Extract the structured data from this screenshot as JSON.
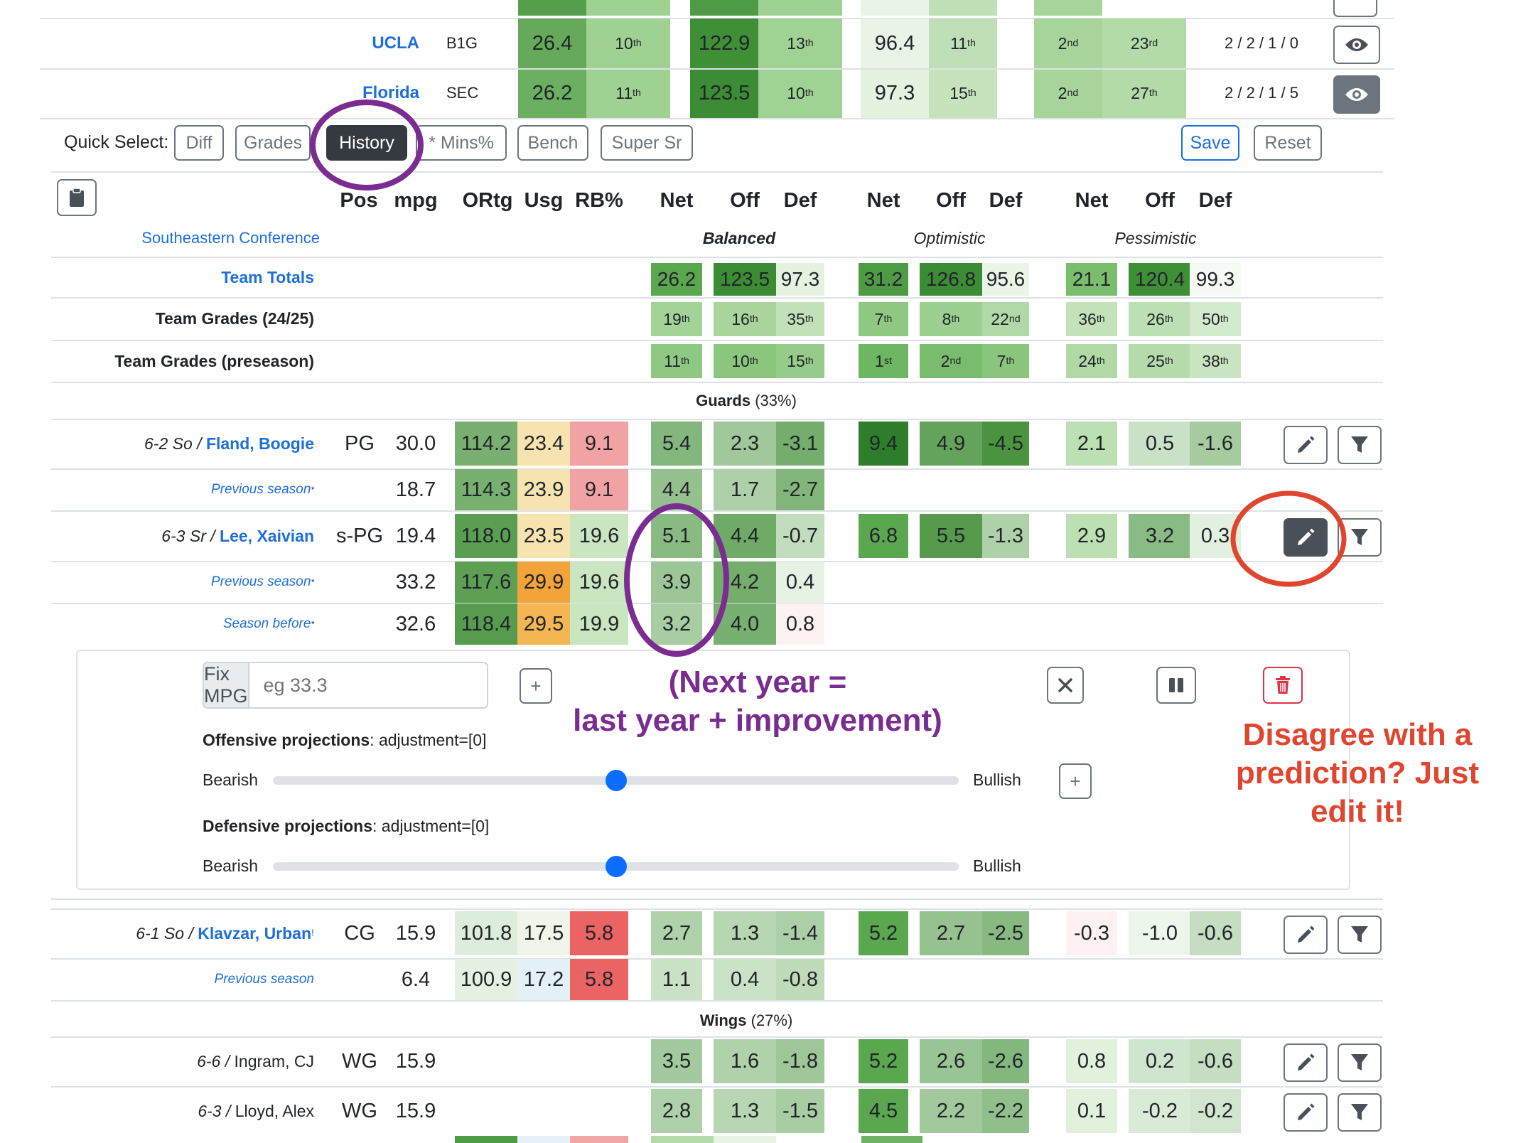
{
  "top_rows": [
    {
      "team": "UCLA",
      "conf": "B1G",
      "adj_margin": "26.4",
      "adj_margin_rank": "10",
      "adj_off": "122.9",
      "adj_off_rank": "13",
      "adj_def": "96.4",
      "adj_def_rank": "11",
      "rank_a": "2",
      "rank_b": "23",
      "record": "2 / 2 / 1 / 0"
    },
    {
      "team": "Florida",
      "conf": "SEC",
      "adj_margin": "26.2",
      "adj_margin_rank": "11",
      "adj_off": "123.5",
      "adj_off_rank": "10",
      "adj_def": "97.3",
      "adj_def_rank": "15",
      "rank_a": "2",
      "rank_b": "27",
      "record": "2 / 2 / 1 / 5"
    }
  ],
  "ordinals": {
    "th": "th",
    "nd": "nd",
    "rd": "rd",
    "st": "st"
  },
  "quick_select": {
    "label": "Quick Select:",
    "buttons": [
      "Diff",
      "Grades",
      "History",
      "* Mins%",
      "Bench",
      "Super Sr"
    ],
    "active": "History",
    "save": "Save",
    "reset": "Reset"
  },
  "columns": {
    "pos": "Pos",
    "mpg": "mpg",
    "ortg": "ORtg",
    "usg": "Usg",
    "rb": "RB%",
    "net": "Net",
    "off": "Off",
    "def": "Def"
  },
  "scenarios": {
    "balanced": "Balanced",
    "optimistic": "Optimistic",
    "pessimistic": "Pessimistic"
  },
  "conference": "Southeastern Conference",
  "team_totals": {
    "label": "Team Totals",
    "values": [
      "26.2",
      "123.5",
      "97.3",
      "31.2",
      "126.8",
      "95.6",
      "21.1",
      "120.4",
      "99.3"
    ]
  },
  "grades_2425": {
    "label": "Team Grades (24/25)",
    "ranks": [
      [
        "19",
        "th"
      ],
      [
        "16",
        "th"
      ],
      [
        "35",
        "th"
      ],
      [
        "7",
        "th"
      ],
      [
        "8",
        "th"
      ],
      [
        "22",
        "nd"
      ],
      [
        "36",
        "th"
      ],
      [
        "26",
        "th"
      ],
      [
        "50",
        "th"
      ]
    ]
  },
  "grades_pre": {
    "label": "Team Grades (preseason)",
    "ranks": [
      [
        "11",
        "th"
      ],
      [
        "10",
        "th"
      ],
      [
        "15",
        "th"
      ],
      [
        "1",
        "st"
      ],
      [
        "2",
        "nd"
      ],
      [
        "7",
        "th"
      ],
      [
        "24",
        "th"
      ],
      [
        "25",
        "th"
      ],
      [
        "38",
        "th"
      ]
    ]
  },
  "sections": {
    "guards": {
      "name": "Guards",
      "pct": "(33%)"
    },
    "wings": {
      "name": "Wings",
      "pct": "(27%)"
    }
  },
  "rows": [
    {
      "info": "6-2 So /",
      "name": "Fland, Boogie",
      "pos": "PG",
      "mpg": "30.0",
      "ortg": "114.2",
      "usg": "23.4",
      "rb": "9.1",
      "b": [
        "5.4",
        "2.3",
        "-3.1"
      ],
      "o": [
        "9.4",
        "4.9",
        "-4.5"
      ],
      "p": [
        "2.1",
        "0.5",
        "-1.6"
      ]
    },
    {
      "prev": "Previous season",
      "star": "*",
      "mpg": "18.7",
      "ortg": "114.3",
      "usg": "23.9",
      "rb": "9.1",
      "b": [
        "4.4",
        "1.7",
        "-2.7"
      ]
    },
    {
      "info": "6-3 Sr /",
      "name": "Lee, Xaivian",
      "pos": "s-PG",
      "mpg": "19.4",
      "ortg": "118.0",
      "usg": "23.5",
      "rb": "19.6",
      "b": [
        "5.1",
        "4.4",
        "-0.7"
      ],
      "o": [
        "6.8",
        "5.5",
        "-1.3"
      ],
      "p": [
        "2.9",
        "3.2",
        "0.3"
      ]
    },
    {
      "prev": "Previous season",
      "star": "*",
      "mpg": "33.2",
      "ortg": "117.6",
      "usg": "29.9",
      "rb": "19.6",
      "b": [
        "3.9",
        "4.2",
        "0.4"
      ]
    },
    {
      "prev": "Season before",
      "star": "*",
      "mpg": "32.6",
      "ortg": "118.4",
      "usg": "29.5",
      "rb": "19.9",
      "b": [
        "3.2",
        "4.0",
        "0.8"
      ]
    },
    {
      "info": "6-1 So /",
      "name": "Klavzar, Urban",
      "bang": "!",
      "pos": "CG",
      "mpg": "15.9",
      "ortg": "101.8",
      "usg": "17.5",
      "rb": "5.8",
      "b": [
        "2.7",
        "1.3",
        "-1.4"
      ],
      "o": [
        "5.2",
        "2.7",
        "-2.5"
      ],
      "p": [
        "-0.3",
        "-1.0",
        "-0.6"
      ]
    },
    {
      "prev": "Previous season",
      "mpg": "6.4",
      "ortg": "100.9",
      "usg": "17.2",
      "rb": "5.8",
      "b": [
        "1.1",
        "0.4",
        "-0.8"
      ]
    },
    {
      "info": "6-6 /",
      "name": "Ingram, CJ",
      "pos": "WG",
      "mpg": "15.9",
      "b": [
        "3.5",
        "1.6",
        "-1.8"
      ],
      "o": [
        "5.2",
        "2.6",
        "-2.6"
      ],
      "p": [
        "0.8",
        "0.2",
        "-0.6"
      ]
    },
    {
      "info": "6-3 /",
      "name": "Lloyd, Alex",
      "pos": "WG",
      "mpg": "15.9",
      "b": [
        "2.8",
        "1.3",
        "-1.5"
      ],
      "o": [
        "4.5",
        "2.2",
        "-2.2"
      ],
      "p": [
        "0.1",
        "-0.2",
        "-0.2"
      ]
    }
  ],
  "editor": {
    "fix_label": "Fix MPG",
    "fix_placeholder": "eg 33.3",
    "plus": "+",
    "offense_title": "Offensive projections",
    "offense_adj": ": adjustment=[0]",
    "defense_title": "Defensive projections",
    "defense_adj": ": adjustment=[0]",
    "bearish": "Bearish",
    "bullish": "Bullish",
    "offense_slider": 0.5,
    "defense_slider": 0.5
  },
  "annotations": {
    "next_year_1": "(Next year =",
    "next_year_2": "last year + improvement)",
    "disagree_1": "Disagree with a",
    "disagree_2": "prediction? Just",
    "disagree_3": "edit it!"
  },
  "colors": {
    "link": "#1e6fd9",
    "annotation_purple": "#7a2c91",
    "annotation_red": "#e0452f",
    "button_dark": "#343a40"
  }
}
